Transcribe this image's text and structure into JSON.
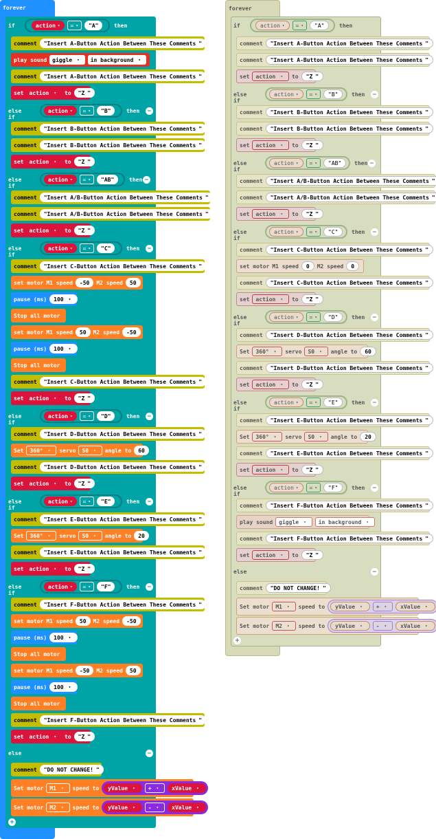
{
  "keywords": {
    "forever": "forever",
    "if": "if",
    "else_if": "else if",
    "else": "else",
    "then": "then",
    "comment": "comment",
    "set": "set",
    "Set": "Set",
    "to": "to",
    "play_sound": "play sound",
    "in_background": "in background",
    "set_motor": "set motor",
    "Set_motor": "Set motor",
    "M1_speed": "M1 speed",
    "M2_speed": "M2 speed",
    "speed_to": "speed to",
    "pause_ms": "pause (ms)",
    "stop_all_motor": "Stop all motor",
    "servo": "servo",
    "angle_to": "angle to"
  },
  "values": {
    "action": "action",
    "eq_op": "=",
    "giggle": "giggle",
    "deg360": "360°",
    "S0": "S0",
    "M1": "M1",
    "M2": "M2",
    "yValue": "yValue",
    "xValue": "xValue",
    "plus": "+",
    "minus": "-",
    "Z": "Z",
    "A": "A",
    "B": "B",
    "AB": "AB",
    "C": "C",
    "D": "D",
    "E": "E",
    "F": "F",
    "n100": "100",
    "n50": "50",
    "nm50": "-50",
    "n0": "0",
    "n60": "60",
    "n20": "20"
  },
  "comments": {
    "a": "Insert A-Button Action Between These Comments",
    "b": "Insert B-Button Action Between These Comments",
    "ab": "Insert A/B-Button Action Between These Comments",
    "c": "Insert C-Button Action Between These Comments",
    "d": "Insert D-Button Action Between These Comments",
    "e": "Insert E-Button Action Between These Comments",
    "f": "Insert F-Button Action Between These Comments",
    "no_change": "DO NOT CHANGE!"
  },
  "colors": {
    "loops": "#1e90ff",
    "logic": "#00a4a6",
    "comment": "#c5bd00",
    "variables": "#dc143c",
    "music": "#e63022",
    "motors": "#ff7f24",
    "math": "#8a2be2",
    "disabled_bg": "#d7d9b7"
  },
  "icons": {
    "minus_circle": "minus-circle-icon",
    "plus_circle": "plus-circle-icon",
    "dropdown": "dropdown-caret-icon"
  }
}
